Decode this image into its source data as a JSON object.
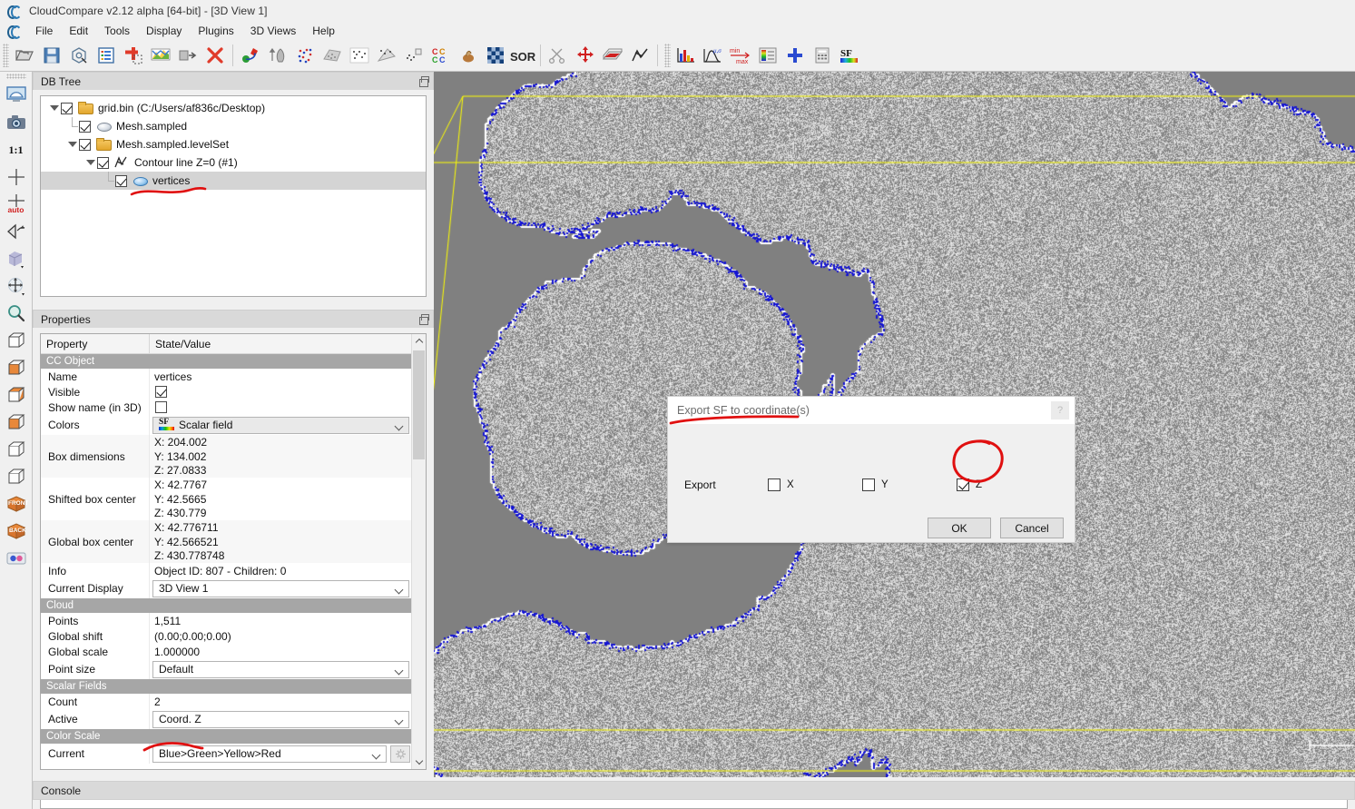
{
  "window": {
    "title": "CloudCompare v2.12 alpha [64-bit] - [3D View 1]",
    "logo_name": "cloudcompare-logo-icon"
  },
  "menu": {
    "items": [
      "File",
      "Edit",
      "Tools",
      "Display",
      "Plugins",
      "3D Views",
      "Help"
    ]
  },
  "toolbar": {
    "groups": [
      {
        "buttons": [
          {
            "name": "open-icon",
            "label": "Open"
          },
          {
            "name": "save-icon",
            "label": "Save"
          },
          {
            "name": "global-shift-settings-icon",
            "label": "Global shift settings"
          },
          {
            "name": "db-tree-icon",
            "label": "Toggle DB tree"
          },
          {
            "name": "properties-icon",
            "label": "Toggle properties"
          },
          {
            "name": "color-ramp-icon",
            "label": "Toggle colour ramp"
          },
          {
            "name": "clone-icon",
            "label": "Clone"
          },
          {
            "name": "delete-icon",
            "label": "Delete"
          }
        ]
      },
      {
        "buttons": [
          {
            "name": "register-icon",
            "label": "Register clouds"
          },
          {
            "name": "align-icon",
            "label": "Align"
          },
          {
            "name": "subsample-icon",
            "label": "Subsample"
          },
          {
            "name": "segment-cloud-icon",
            "label": "Segment"
          },
          {
            "name": "cloud-cloud-dist-icon",
            "label": "Cloud/cloud distance"
          },
          {
            "name": "cloud-mesh-dist-icon",
            "label": "Cloud/mesh distance"
          },
          {
            "name": "cloud-primitive-dist-icon",
            "label": "Cloud/primitive distance"
          },
          {
            "name": "compute-cc-icon",
            "label": "Label connected components"
          },
          {
            "name": "fit-plane-icon",
            "label": "Fit plane"
          },
          {
            "name": "checkerboard-icon",
            "label": "Sample mesh"
          },
          {
            "name": "sor-filter-icon",
            "label": "SOR filter"
          }
        ]
      },
      {
        "buttons": [
          {
            "name": "scissors-icon",
            "label": "Segment"
          },
          {
            "name": "translate-rotate-icon",
            "label": "Translate / rotate"
          },
          {
            "name": "cross-section-icon",
            "label": "Cross section"
          },
          {
            "name": "polyline-tool-icon",
            "label": "Trace polyline"
          }
        ]
      },
      {
        "buttons": [
          {
            "name": "histogram-icon",
            "label": "Compute histogram"
          },
          {
            "name": "stats-icon",
            "label": "Statistical test"
          },
          {
            "name": "min-max-icon",
            "label": "Filter by value"
          },
          {
            "name": "color-scale-editor-icon",
            "label": "Colour scale editor"
          },
          {
            "name": "add-sf-icon",
            "label": "Add constant SF"
          },
          {
            "name": "sf-arithmetic-icon",
            "label": "SF arithmetic"
          },
          {
            "name": "sf-to-coord-icon",
            "label": "Export SF to coordinate(s)"
          }
        ]
      }
    ]
  },
  "left_toolbar": {
    "buttons": [
      {
        "name": "set-view-global-zoom-icon",
        "label": "Global zoom"
      },
      {
        "name": "camera-snapshot-icon",
        "label": "Render to file"
      },
      {
        "name": "zoom-one-to-one-icon",
        "label": "1:1"
      },
      {
        "name": "pick-rotation-center-icon",
        "label": "Pick rotation center"
      },
      {
        "name": "auto-pick-rotation-center-icon",
        "label": "auto"
      },
      {
        "name": "toggle-perspective-icon",
        "label": "Toggle perspective"
      },
      {
        "name": "toggle-cube-icon",
        "label": "Display settings"
      },
      {
        "name": "translate-mode-icon",
        "label": "Translate"
      },
      {
        "name": "zoom-tool-icon",
        "label": "Zoom"
      },
      {
        "name": "view-top-icon",
        "label": "Top view"
      },
      {
        "name": "view-bottom-icon",
        "label": "Bottom view"
      },
      {
        "name": "view-left-icon",
        "label": "Left view"
      },
      {
        "name": "view-right-icon",
        "label": "Right view"
      },
      {
        "name": "view-iso1-icon",
        "label": "Isometric view 1"
      },
      {
        "name": "view-iso2-icon",
        "label": "Isometric view 2"
      },
      {
        "name": "view-front-icon",
        "label": "FRONT"
      },
      {
        "name": "view-back-icon",
        "label": "BACK"
      },
      {
        "name": "stereo-mode-icon",
        "label": "Stereo mode"
      }
    ],
    "labels": {
      "one_to_one": "1:1",
      "auto": "auto",
      "front": "FRONT",
      "back": "BACK"
    }
  },
  "db_tree": {
    "panel_title": "DB Tree",
    "items": [
      {
        "label": "grid.bin (C:/Users/af836c/Desktop)",
        "icon": "folder-icon",
        "depth": 0,
        "checked": true,
        "expanded": true,
        "selected": false
      },
      {
        "label": "Mesh.sampled",
        "icon": "point-cloud-gray-icon",
        "depth": 1,
        "checked": true,
        "expanded": false,
        "selected": false
      },
      {
        "label": "Mesh.sampled.levelSet",
        "icon": "folder-icon",
        "depth": 1,
        "checked": true,
        "expanded": true,
        "selected": false
      },
      {
        "label": "Contour line Z=0 (#1)",
        "icon": "polyline-icon",
        "depth": 2,
        "checked": true,
        "expanded": true,
        "selected": false
      },
      {
        "label": "vertices",
        "icon": "point-cloud-blue-icon",
        "depth": 3,
        "checked": true,
        "expanded": false,
        "selected": true
      }
    ]
  },
  "properties": {
    "panel_title": "Properties",
    "headers": {
      "property": "Property",
      "value": "State/Value"
    },
    "sections": [
      {
        "title": "CC Object",
        "rows": [
          {
            "key": "Name",
            "type": "text",
            "value": "vertices"
          },
          {
            "key": "Visible",
            "type": "checkbox",
            "value": true
          },
          {
            "key": "Show name (in 3D)",
            "type": "checkbox",
            "value": false
          },
          {
            "key": "Colors",
            "type": "combo-sf",
            "value": "Scalar field"
          },
          {
            "key": "Box dimensions",
            "type": "multiline",
            "value": [
              "X: 204.002",
              "Y: 134.002",
              "Z: 27.0833"
            ]
          },
          {
            "key": "Shifted box center",
            "type": "multiline",
            "value": [
              "X: 42.7767",
              "Y: 42.5665",
              "Z: 430.779"
            ]
          },
          {
            "key": "Global box center",
            "type": "multiline",
            "value": [
              "X: 42.776711",
              "Y: 42.566521",
              "Z: 430.778748"
            ]
          },
          {
            "key": "Info",
            "type": "text",
            "value": "Object ID: 807 - Children: 0"
          },
          {
            "key": "Current Display",
            "type": "combo",
            "value": "3D View 1"
          }
        ]
      },
      {
        "title": "Cloud",
        "rows": [
          {
            "key": "Points",
            "type": "text",
            "value": "1,511"
          },
          {
            "key": "Global shift",
            "type": "text",
            "value": "(0.00;0.00;0.00)"
          },
          {
            "key": "Global scale",
            "type": "text",
            "value": "1.000000"
          },
          {
            "key": "Point size",
            "type": "combo",
            "value": "Default"
          }
        ]
      },
      {
        "title": "Scalar Fields",
        "rows": [
          {
            "key": "Count",
            "type": "text",
            "value": "2"
          },
          {
            "key": "Active",
            "type": "combo",
            "value": "Coord. Z"
          }
        ]
      },
      {
        "title": "Color Scale",
        "rows": [
          {
            "key": "Current",
            "type": "combo-gear",
            "value": "Blue>Green>Yellow>Red"
          }
        ]
      }
    ]
  },
  "dialog": {
    "title": "Export SF to coordinate(s)",
    "export_label": "Export",
    "checkboxes": [
      {
        "label": "X",
        "checked": false,
        "name": "export-x-checkbox"
      },
      {
        "label": "Y",
        "checked": false,
        "name": "export-y-checkbox"
      },
      {
        "label": "Z",
        "checked": true,
        "name": "export-z-checkbox"
      }
    ],
    "ok_label": "OK",
    "cancel_label": "Cancel",
    "help_glyph": "?"
  },
  "console": {
    "panel_title": "Console"
  },
  "view3d": {
    "background_color": "#808080",
    "point_cloud_color": "#c8c8c8",
    "contour_color": "#1414d2",
    "bounding_box_color": "#ffff00",
    "scale_bar_color": "#ffffff"
  },
  "annotations": {
    "color": "#e01010",
    "marks": [
      {
        "name": "underline-vertices",
        "type": "underline"
      },
      {
        "name": "underline-active-sf",
        "type": "underline"
      },
      {
        "name": "underline-dialog-title",
        "type": "underline"
      },
      {
        "name": "circle-export-z",
        "type": "circle"
      }
    ]
  }
}
